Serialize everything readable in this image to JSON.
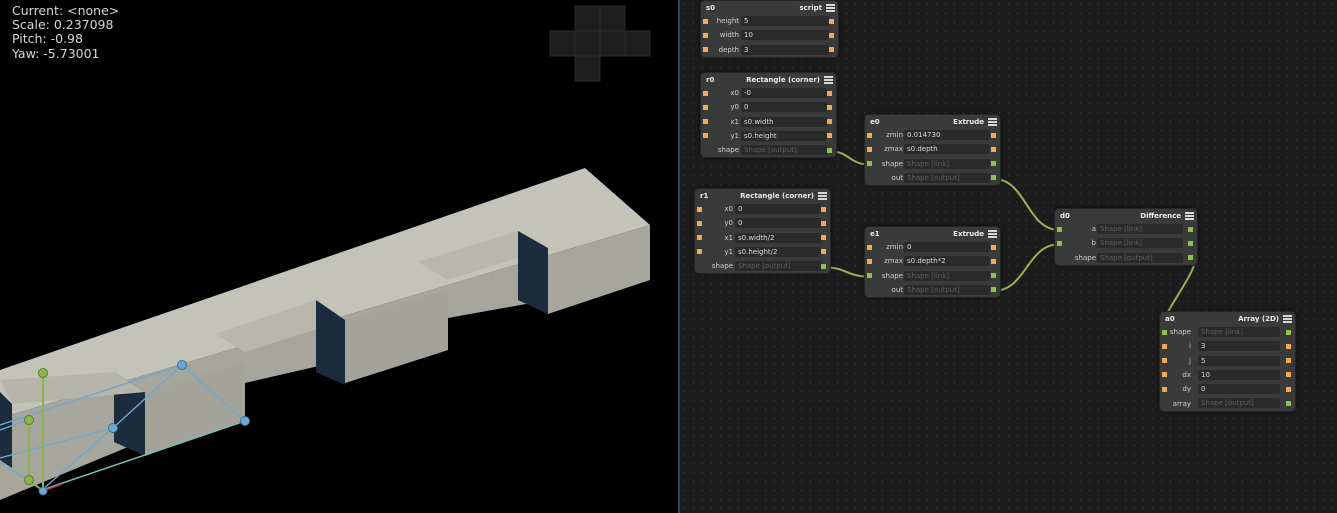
{
  "viewport": {
    "status": {
      "current": "Current: <none>",
      "scale": "Scale: 0.237098",
      "pitch": "Pitch: -0.98",
      "yaw": "Yaw: -5.73001"
    }
  },
  "colors": {
    "viewport_bg": "#000000",
    "graph_bg": "#1c1c1c",
    "node_bg": "#3a3a3a",
    "field_bg": "#2a2a2a",
    "number_port": "#f0a85a",
    "shape_port": "#8fc04e",
    "wire": "#9ab154",
    "solid_top": "#c3c3b8",
    "solid_front": "#a6a69c",
    "solid_dark": "#1c2b3d",
    "handle_green": "#8db54b",
    "handle_blue": "#6ea8cf"
  },
  "nodes": {
    "s0": {
      "name": "s0",
      "type": "script",
      "rows": [
        {
          "label": "height",
          "value": "5"
        },
        {
          "label": "width",
          "value": "10"
        },
        {
          "label": "depth",
          "value": "3"
        }
      ]
    },
    "r0": {
      "name": "r0",
      "type": "Rectangle (corner)",
      "rows": [
        {
          "label": "x0",
          "value": "-0"
        },
        {
          "label": "y0",
          "value": "0"
        },
        {
          "label": "x1",
          "value": "s0.width"
        },
        {
          "label": "y1",
          "value": "s0.height"
        },
        {
          "label": "shape",
          "value": "Shape [output]"
        }
      ]
    },
    "r1": {
      "name": "r1",
      "type": "Rectangle (corner)",
      "rows": [
        {
          "label": "x0",
          "value": "0"
        },
        {
          "label": "y0",
          "value": "0"
        },
        {
          "label": "x1",
          "value": "s0.width/2"
        },
        {
          "label": "y1",
          "value": "s0.height/2"
        },
        {
          "label": "shape",
          "value": "Shape [output]"
        }
      ]
    },
    "e0": {
      "name": "e0",
      "type": "Extrude",
      "rows": [
        {
          "label": "zmin",
          "value": "0.014730"
        },
        {
          "label": "zmax",
          "value": "s0.depth"
        },
        {
          "label": "shape",
          "value": "Shape [link]"
        },
        {
          "label": "out",
          "value": "Shape [output]"
        }
      ]
    },
    "e1": {
      "name": "e1",
      "type": "Extrude",
      "rows": [
        {
          "label": "zmin",
          "value": "0"
        },
        {
          "label": "zmax",
          "value": "s0.depth*2"
        },
        {
          "label": "shape",
          "value": "Shape [link]"
        },
        {
          "label": "out",
          "value": "Shape [output]"
        }
      ]
    },
    "d0": {
      "name": "d0",
      "type": "Difference",
      "rows": [
        {
          "label": "a",
          "value": "Shape [link]"
        },
        {
          "label": "b",
          "value": "Shape [link]"
        },
        {
          "label": "shape",
          "value": "Shape [output]"
        }
      ]
    },
    "a0": {
      "name": "a0",
      "type": "Array (2D)",
      "rows": [
        {
          "label": "shape",
          "value": "Shape [link]"
        },
        {
          "label": "i",
          "value": "3"
        },
        {
          "label": "j",
          "value": "5"
        },
        {
          "label": "dx",
          "value": "10"
        },
        {
          "label": "dy",
          "value": "0"
        },
        {
          "label": "array",
          "value": "Shape [output]"
        }
      ]
    }
  },
  "connections": [
    {
      "from": "r0.shape",
      "to": "e0.shape"
    },
    {
      "from": "r1.shape",
      "to": "e1.shape"
    },
    {
      "from": "e0.out",
      "to": "d0.a"
    },
    {
      "from": "e1.out",
      "to": "d0.b"
    },
    {
      "from": "d0.shape",
      "to": "a0.shape"
    }
  ]
}
